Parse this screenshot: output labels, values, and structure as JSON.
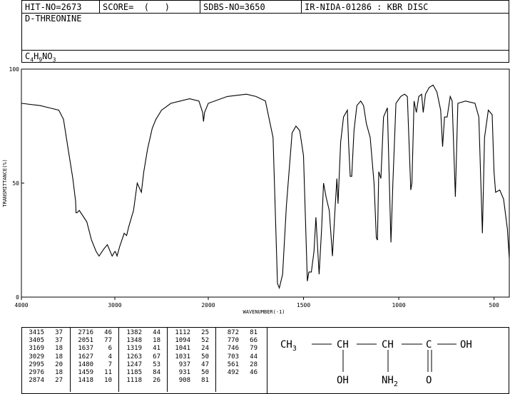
{
  "header": {
    "hit_no": "HIT-NO=2673",
    "score": "SCORE=  (   )",
    "sdbs_no": "SDBS-NO=3650",
    "ir_id": "IR-NIDA-01286 : KBR DISC"
  },
  "compound": {
    "name": "D-THREONINE",
    "formula_parts": [
      "C",
      "4",
      "H",
      "9",
      "NO",
      "3"
    ]
  },
  "chart_data": {
    "type": "line",
    "xlabel": "WAVENUMBER(-1)",
    "ylabel": "TRANSMITTANCE(%)",
    "xlim": [
      4000,
      420
    ],
    "ylim": [
      0,
      100
    ],
    "x_ticks": [
      4000,
      3000,
      2000,
      1500,
      1000,
      500
    ],
    "y_ticks": [
      0,
      50,
      100
    ],
    "grid": false,
    "series": [
      {
        "x": [
          4000,
          3800,
          3700,
          3600,
          3550,
          3500,
          3450,
          3420,
          3415,
          3405,
          3380,
          3300,
          3250,
          3200,
          3169,
          3120,
          3080,
          3029,
          3000,
          2995,
          2976,
          2950,
          2900,
          2874,
          2850,
          2800,
          2760,
          2716,
          2690,
          2650,
          2600,
          2560,
          2500,
          2400,
          2300,
          2200,
          2100,
          2060,
          2051,
          2040,
          2000,
          1900,
          1800,
          1750,
          1700,
          1660,
          1637,
          1627,
          1610,
          1590,
          1560,
          1540,
          1520,
          1500,
          1480,
          1472,
          1459,
          1445,
          1435,
          1418,
          1405,
          1395,
          1382,
          1365,
          1348,
          1335,
          1325,
          1319,
          1305,
          1290,
          1270,
          1263,
          1255,
          1247,
          1235,
          1220,
          1200,
          1185,
          1170,
          1150,
          1130,
          1118,
          1112,
          1105,
          1094,
          1080,
          1060,
          1041,
          1031,
          1015,
          990,
          970,
          955,
          937,
          931,
          920,
          908,
          895,
          880,
          872,
          860,
          840,
          820,
          800,
          780,
          770,
          760,
          746,
          730,
          720,
          703,
          690,
          650,
          600,
          580,
          561,
          550,
          530,
          510,
          500,
          492,
          470,
          450,
          430,
          420
        ],
        "y": [
          85,
          84,
          83,
          82,
          78,
          65,
          52,
          42,
          37,
          37,
          38,
          33,
          25,
          20,
          18,
          21,
          23,
          18,
          20,
          20,
          18,
          22,
          28,
          27,
          31,
          38,
          50,
          46,
          55,
          65,
          74,
          78,
          82,
          85,
          86,
          87,
          86,
          81,
          77,
          81,
          85,
          88,
          89,
          88,
          86,
          70,
          6,
          4,
          10,
          40,
          72,
          75,
          73,
          62,
          7,
          11,
          11,
          20,
          35,
          10,
          30,
          50,
          44,
          38,
          18,
          38,
          52,
          41,
          68,
          79,
          82,
          67,
          53,
          53,
          73,
          84,
          86,
          84,
          76,
          70,
          50,
          26,
          25,
          55,
          52,
          79,
          83,
          24,
          50,
          85,
          88,
          89,
          88,
          47,
          50,
          86,
          81,
          88,
          89,
          81,
          89,
          92,
          93,
          90,
          82,
          66,
          79,
          79,
          88,
          86,
          44,
          85,
          86,
          85,
          79,
          28,
          70,
          82,
          80,
          55,
          46,
          47,
          43,
          30,
          17
        ]
      }
    ]
  },
  "peak_table": {
    "columns": [
      {
        "wn": [
          "3415",
          "3405",
          "3169",
          "3029",
          "2995",
          "2976",
          "2874"
        ],
        "t": [
          "37",
          "37",
          "18",
          "18",
          "20",
          "18",
          "27"
        ]
      },
      {
        "wn": [
          "2716",
          "2051",
          "1637",
          "1627",
          "1480",
          "1459",
          "1418"
        ],
        "t": [
          "46",
          "77",
          "6",
          "4",
          "7",
          "11",
          "10"
        ]
      },
      {
        "wn": [
          "1382",
          "1348",
          "1319",
          "1263",
          "1247",
          "1185",
          "1118"
        ],
        "t": [
          "44",
          "18",
          "41",
          "67",
          "53",
          "84",
          "26"
        ]
      },
      {
        "wn": [
          "1112",
          "1094",
          "1041",
          "1031",
          "937",
          "931",
          "908"
        ],
        "t": [
          "25",
          "52",
          "24",
          "50",
          "47",
          "50",
          "81"
        ]
      },
      {
        "wn": [
          "872",
          "770",
          "746",
          "703",
          "561",
          "492"
        ],
        "t": [
          "81",
          "66",
          "79",
          "44",
          "28",
          "46"
        ]
      }
    ]
  },
  "structure": {
    "ch3": "CH",
    "ch3_sub": "3",
    "ch_a": "CH",
    "ch_b": "CH",
    "c": "C",
    "oh_right": "OH",
    "oh_bottom": "OH",
    "nh2": "NH",
    "nh2_sub": "2",
    "o": "O"
  }
}
